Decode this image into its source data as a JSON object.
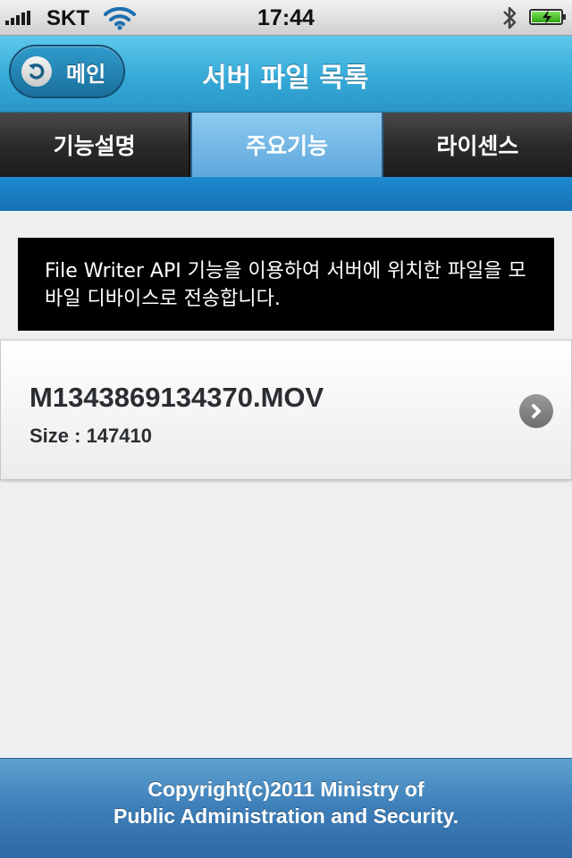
{
  "status_bar": {
    "carrier": "SKT",
    "time": "17:44"
  },
  "nav": {
    "back_label": "메인",
    "title": "서버 파일 목록"
  },
  "tabs": [
    {
      "label": "기능설명",
      "active": false
    },
    {
      "label": "주요기능",
      "active": true
    },
    {
      "label": "라이센스",
      "active": false
    }
  ],
  "description": "File Writer API 기능을 이용하여 서버에 위치한 파일을 모바일 디바이스로 전송합니다.",
  "files": [
    {
      "name": "M1343869134370.MOV",
      "size": "Size : 147410"
    }
  ],
  "footer": {
    "line1": "Copyright(c)2011 Ministry of",
    "line2": "Public Administration and Security."
  },
  "icons": {
    "back": "back-arrow-icon",
    "chevron": "chevron-right-icon",
    "wifi": "wifi-icon",
    "bluetooth": "bluetooth-icon",
    "battery": "battery-icon"
  }
}
